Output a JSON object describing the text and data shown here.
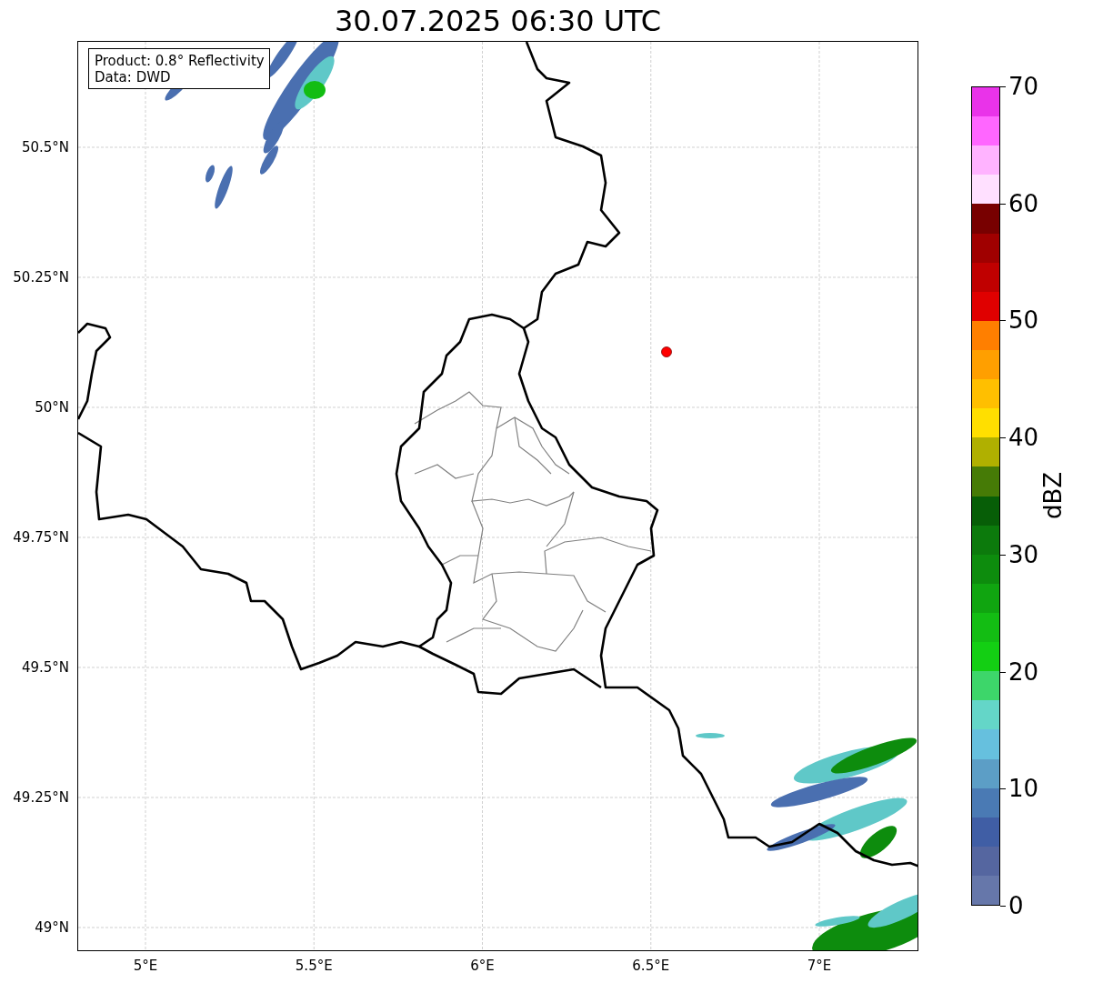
{
  "title": "30.07.2025 06:30 UTC",
  "legend": [
    "Product: 0.8° Reflectivity",
    "Data: DWD"
  ],
  "y_ticks": [
    "50.5°N",
    "50.25°N",
    "50°N",
    "49.75°N",
    "49.5°N",
    "49.25°N",
    "49°N"
  ],
  "x_ticks": [
    "5°E",
    "5.5°E",
    "6°E",
    "6.5°E",
    "7°E"
  ],
  "colorbar": {
    "label": "dBZ",
    "ticks": [
      "70",
      "60",
      "50",
      "40",
      "30",
      "20",
      "10",
      "0"
    ],
    "bands": [
      {
        "color": "#e933e9"
      },
      {
        "color": "#ff66ff"
      },
      {
        "color": "#ffb3ff"
      },
      {
        "color": "#ffe0ff"
      },
      {
        "color": "#780000"
      },
      {
        "color": "#a00000"
      },
      {
        "color": "#c00000"
      },
      {
        "color": "#e00000"
      },
      {
        "color": "#ff7f00"
      },
      {
        "color": "#ff9f00"
      },
      {
        "color": "#ffbf00"
      },
      {
        "color": "#ffdf00"
      },
      {
        "color": "#b0b000"
      },
      {
        "color": "#467b06"
      },
      {
        "color": "#075e07"
      },
      {
        "color": "#0c7a0c"
      },
      {
        "color": "#0d8c0d"
      },
      {
        "color": "#10a510"
      },
      {
        "color": "#13bd13"
      },
      {
        "color": "#13cf13"
      },
      {
        "color": "#3dd66a"
      },
      {
        "color": "#64d6c8"
      },
      {
        "color": "#66c0de"
      },
      {
        "color": "#5c9ec6"
      },
      {
        "color": "#4a7ab4"
      },
      {
        "color": "#405ea5"
      },
      {
        "color": "#5566a0"
      },
      {
        "color": "#6677aa"
      }
    ]
  }
}
